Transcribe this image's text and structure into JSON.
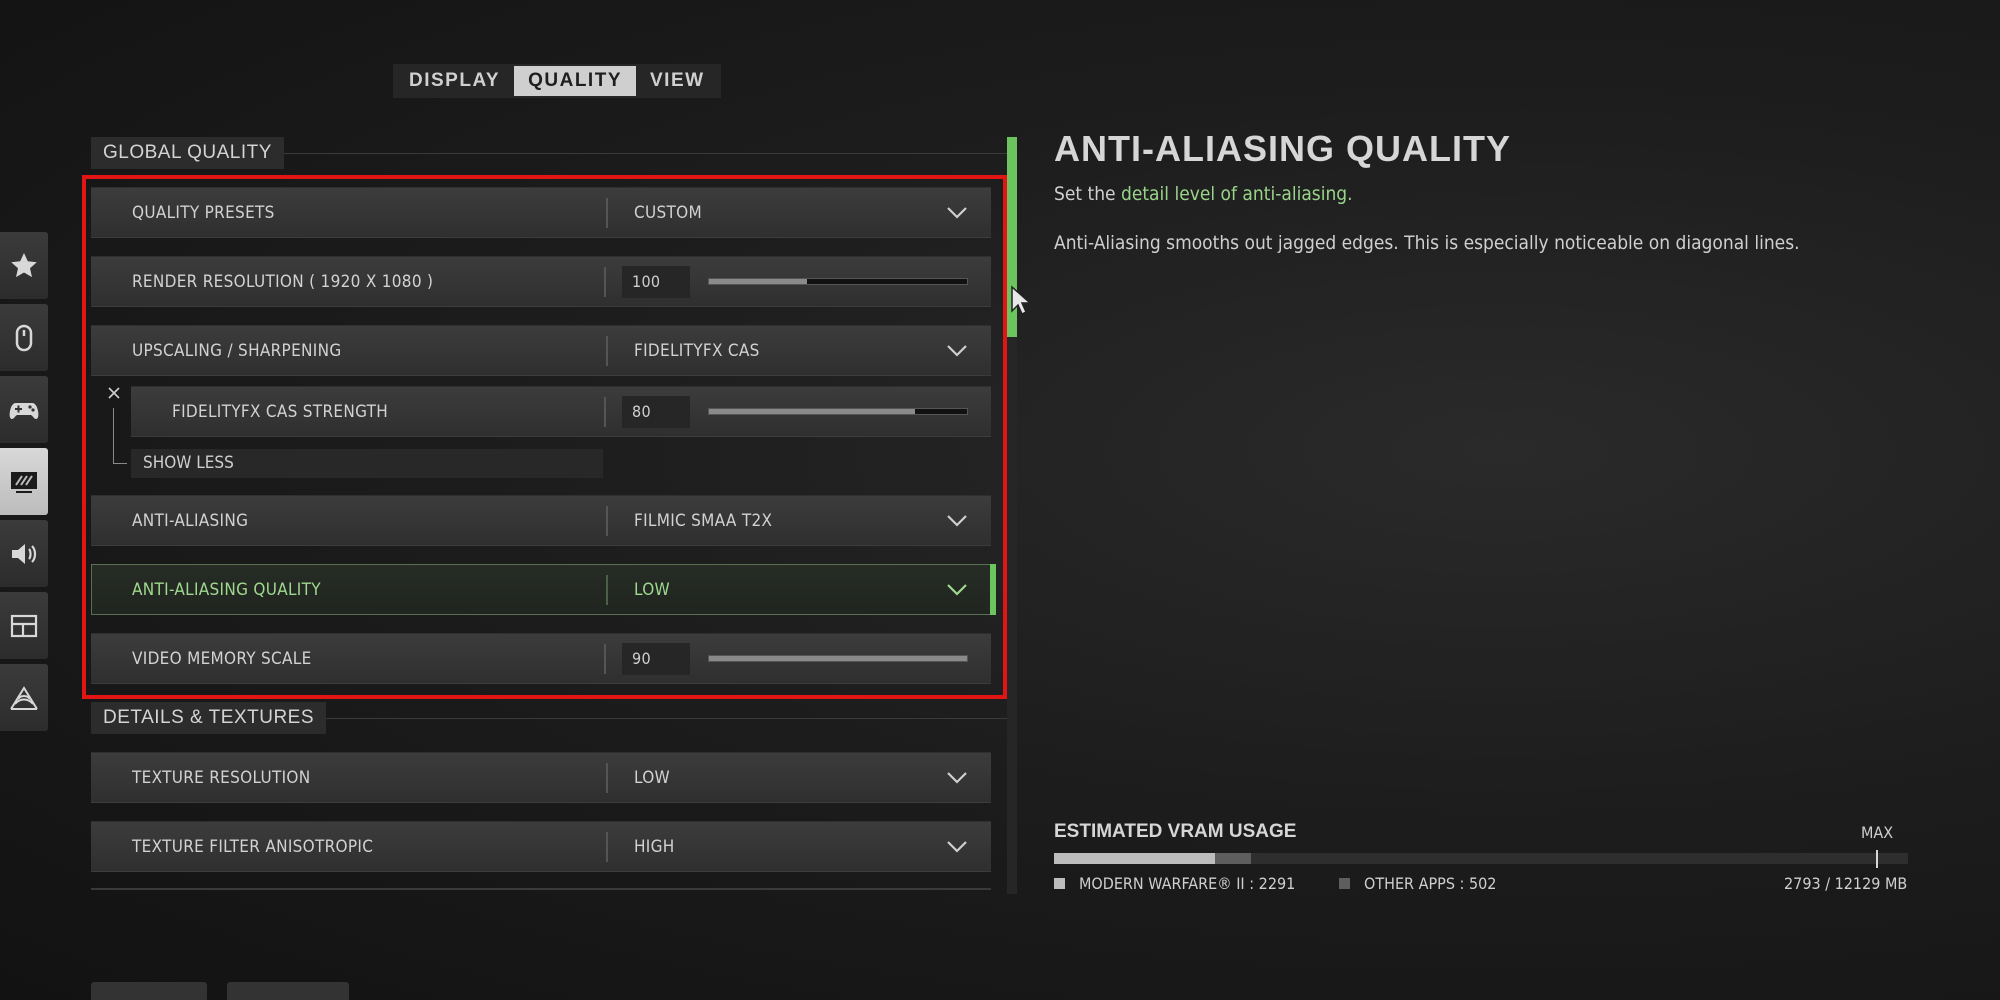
{
  "tabs": [
    {
      "label": "DISPLAY",
      "active": false
    },
    {
      "label": "QUALITY",
      "active": true
    },
    {
      "label": "VIEW",
      "active": false
    }
  ],
  "left_nav": [
    {
      "icon": "star-icon"
    },
    {
      "icon": "mouse-icon"
    },
    {
      "icon": "gamepad-icon"
    },
    {
      "icon": "graphics-icon",
      "active": true
    },
    {
      "icon": "speaker-icon"
    },
    {
      "icon": "interface-icon"
    },
    {
      "icon": "network-icon"
    }
  ],
  "sections": {
    "global_quality": "GLOBAL QUALITY",
    "details_textures": "DETAILS & TEXTURES"
  },
  "settings": {
    "quality_presets": {
      "label": "QUALITY PRESETS",
      "value": "CUSTOM"
    },
    "render_resolution": {
      "label": "RENDER RESOLUTION ( 1920 X 1080 )",
      "value": "100",
      "fill": 0.38
    },
    "upscaling": {
      "label": "UPSCALING / SHARPENING",
      "value": "FIDELITYFX CAS"
    },
    "cas_strength": {
      "label": "FIDELITYFX CAS STRENGTH",
      "value": "80",
      "fill": 0.8
    },
    "show_less": "SHOW LESS",
    "anti_aliasing": {
      "label": "ANTI-ALIASING",
      "value": "FILMIC SMAA T2X"
    },
    "aa_quality": {
      "label": "ANTI-ALIASING QUALITY",
      "value": "LOW"
    },
    "video_memory_scale": {
      "label": "VIDEO MEMORY SCALE",
      "value": "90",
      "fill": 1.0
    },
    "texture_resolution": {
      "label": "TEXTURE RESOLUTION",
      "value": "LOW"
    },
    "texture_filter": {
      "label": "TEXTURE FILTER ANISOTROPIC",
      "value": "HIGH"
    }
  },
  "detail": {
    "title": "ANTI-ALIASING QUALITY",
    "sub_prefix": "Set the ",
    "sub_highlight": "detail level of anti-aliasing.",
    "description": "Anti-Aliasing smooths out jagged edges. This is especially noticeable on diagonal lines."
  },
  "vram": {
    "title": "ESTIMATED VRAM USAGE",
    "max_label": "MAX",
    "mw_label": "MODERN WARFARE® II : 2291",
    "other_label": "OTHER APPS : 502",
    "total_label": "2793 / 12129 MB",
    "mw_value": 2291,
    "other_value": 502,
    "total_capacity": 12129,
    "colors": {
      "mw": "#bdbdbd",
      "other": "#5e5e5e",
      "accent": "#6cc45e"
    }
  }
}
